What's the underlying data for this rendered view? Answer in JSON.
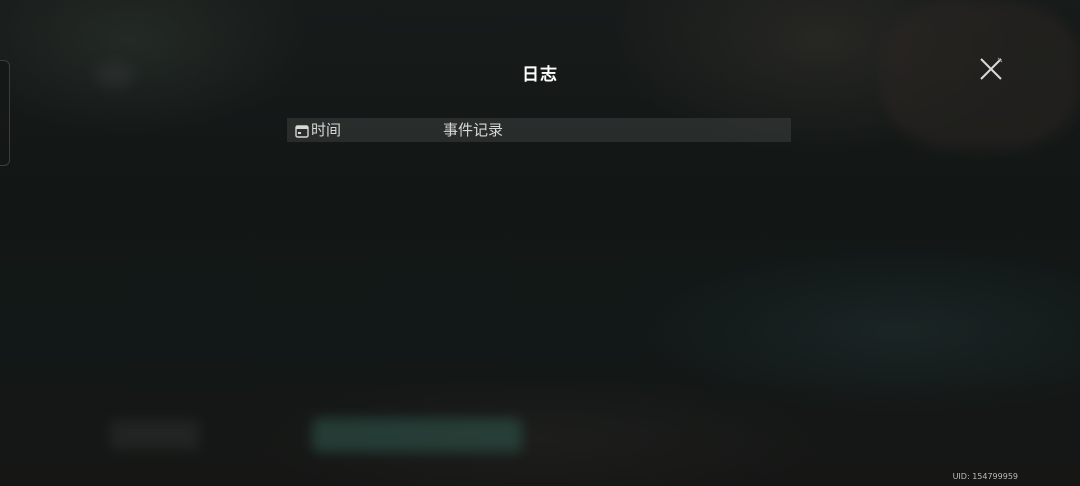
{
  "dialog": {
    "title": "日志",
    "close_icon": "close-icon"
  },
  "table": {
    "columns": [
      {
        "label": "时间",
        "icon": "calendar-icon"
      },
      {
        "label": "事件记录"
      }
    ],
    "rows": []
  },
  "footer": {
    "uid_text": "UID: 154799959"
  },
  "colors": {
    "background": "#121716",
    "header_row": "#3a3f3e",
    "title_text": "#ffffff",
    "header_text": "#d6d8d6"
  }
}
